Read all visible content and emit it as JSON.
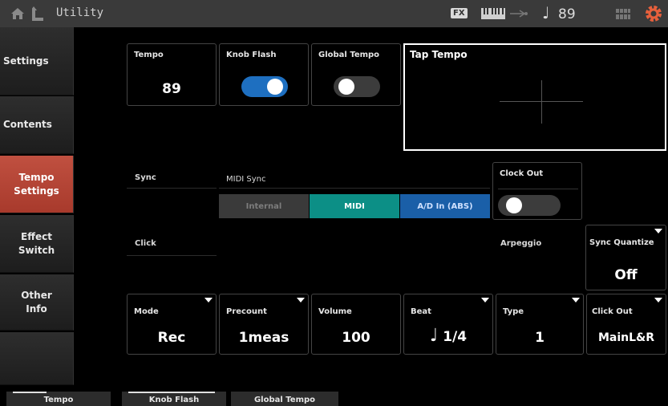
{
  "topbar": {
    "title": "Utility",
    "fx_badge": "FX",
    "tempo": "89",
    "icons": [
      "home-icon",
      "up-arrow-icon",
      "keyboard-icon",
      "usb-icon",
      "note-icon",
      "grid-icon",
      "gear-icon"
    ],
    "gear_color": "#e8603c"
  },
  "sidebar": {
    "items": [
      {
        "label": "Settings"
      },
      {
        "label": "Contents"
      },
      {
        "label": "Tempo\nSettings",
        "active": true
      },
      {
        "label": "Effect\nSwitch"
      },
      {
        "label": "Other\nInfo"
      }
    ],
    "active_color": "#b4473a"
  },
  "main": {
    "tempo": {
      "label": "Tempo",
      "value": "89"
    },
    "knob_flash": {
      "label": "Knob Flash",
      "state": "on"
    },
    "global_tempo": {
      "label": "Global Tempo",
      "state": "off"
    },
    "tap_tempo": {
      "label": "Tap Tempo"
    },
    "sync": {
      "label": "Sync",
      "midi_sync_label": "MIDI Sync",
      "options": [
        "Internal",
        "MIDI",
        "A/D In (ABS)"
      ],
      "selected": "MIDI",
      "clock_out": {
        "label": "Clock Out",
        "state": "off"
      }
    },
    "click": {
      "label": "Click",
      "arpeggio_label": "Arpeggio",
      "sync_quantize": {
        "label": "Sync Quantize",
        "value": "Off"
      },
      "mode": {
        "label": "Mode",
        "value": "Rec"
      },
      "precount": {
        "label": "Precount",
        "value": "1meas"
      },
      "volume": {
        "label": "Volume",
        "value": "100"
      },
      "beat": {
        "label": "Beat",
        "value": "1/4",
        "note_glyph": "♩"
      },
      "type": {
        "label": "Type",
        "value": "1"
      },
      "click_out": {
        "label": "Click Out",
        "value": "MainL&R"
      }
    }
  },
  "bottom_tabs": [
    "Tempo",
    "Knob Flash",
    "Global Tempo"
  ],
  "colors": {
    "toggle_on": "#1e6fc0",
    "midi_selected": "#0c8f86",
    "ad_in": "#1a5fa8"
  }
}
